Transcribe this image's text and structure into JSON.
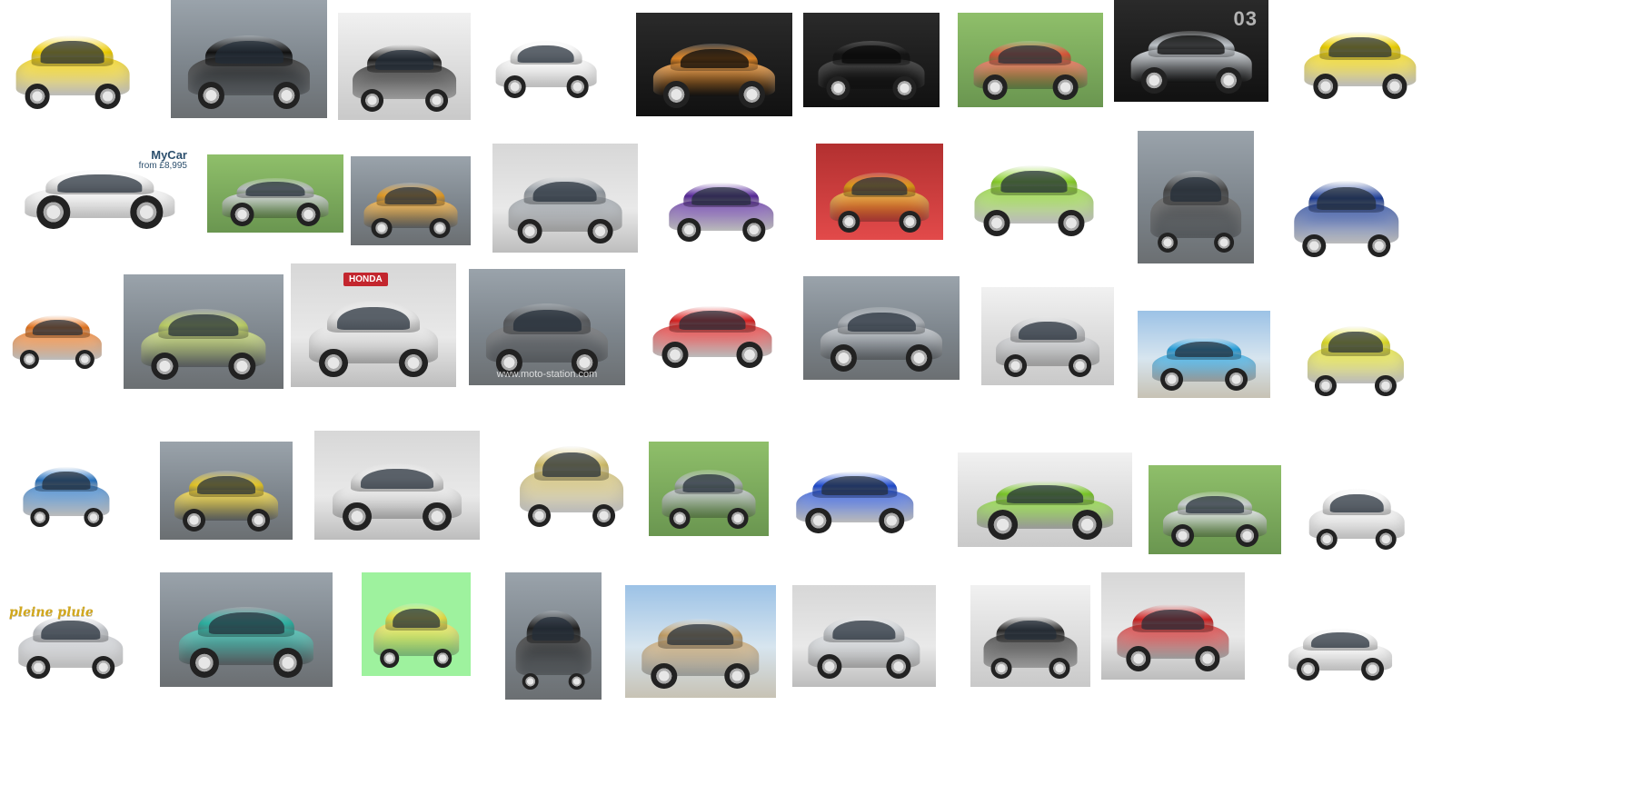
{
  "tiles": [
    {
      "name": "car-buggy-yellow-gray",
      "color": "#f2d000",
      "theme": "white"
    },
    {
      "name": "car-roadster-black-red",
      "color": "#121212",
      "theme": "street"
    },
    {
      "name": "car-microcar-black",
      "color": "#1f1f1f",
      "theme": "gray"
    },
    {
      "name": "car-hatch-white",
      "color": "#f7f7f7",
      "theme": "white"
    },
    {
      "name": "car-suv-orange",
      "color": "#e98c28",
      "theme": "dark"
    },
    {
      "name": "car-hatch-black-red",
      "color": "#161616",
      "theme": "dark"
    },
    {
      "name": "car-bubble-red",
      "color": "#e45b3e",
      "theme": "green"
    },
    {
      "name": "car-pod-silver",
      "color": "#c9cfd5",
      "theme": "dark",
      "label": "03"
    },
    {
      "name": "car-bubble-yellow",
      "color": "#f1d400",
      "theme": "white"
    },
    {
      "name": "car-mycar-white",
      "color": "#f4f4f4",
      "theme": "white",
      "badge_title": "MyCar",
      "badge_sub": "from £8,995"
    },
    {
      "name": "car-hatch-silver",
      "color": "#c8ccd1",
      "theme": "green"
    },
    {
      "name": "car-minivan-orange",
      "color": "#f0a52a",
      "theme": "street"
    },
    {
      "name": "car-concept-silver",
      "color": "#9aa1a8",
      "theme": "show"
    },
    {
      "name": "car-hatch-purple",
      "color": "#5b2aa0",
      "theme": "white"
    },
    {
      "name": "car-concept-yellow",
      "color": "#e6a41a",
      "theme": "red"
    },
    {
      "name": "car-hatch-lime",
      "color": "#8ad22a",
      "theme": "white"
    },
    {
      "name": "car-compact-graphite",
      "color": "#4a4a4a",
      "theme": "street"
    },
    {
      "name": "car-gem-blue-white",
      "color": "#1d3f9a",
      "theme": "white"
    },
    {
      "name": "car-hatch-orange",
      "color": "#f07a20",
      "theme": "white"
    },
    {
      "name": "car-bubble-lime",
      "color": "#c2d56a",
      "theme": "street"
    },
    {
      "name": "car-honda-open",
      "color": "#e8e8e8",
      "theme": "show",
      "label": "HONDA"
    },
    {
      "name": "car-concept-gray",
      "color": "#5d5f62",
      "theme": "street",
      "label": "www.moto-station.com"
    },
    {
      "name": "car-boxy-red-white",
      "color": "#e02222",
      "theme": "white"
    },
    {
      "name": "car-concept-silver-2",
      "color": "#b7bcc2",
      "theme": "street"
    },
    {
      "name": "car-pod-gray",
      "color": "#c7c9cc",
      "theme": "gray"
    },
    {
      "name": "car-convertible-blue",
      "color": "#2aa8e6",
      "theme": "sky"
    },
    {
      "name": "car-buggy-yellow-black",
      "color": "#e2e02a",
      "theme": "white"
    },
    {
      "name": "car-front-blue",
      "color": "#2b79c9",
      "theme": "white"
    },
    {
      "name": "car-bubble-yellow-2",
      "color": "#f0d02a",
      "theme": "street"
    },
    {
      "name": "car-pod-white-black",
      "color": "#e9e9e9",
      "theme": "show"
    },
    {
      "name": "car-twizy-gold",
      "color": "#d2bf6b",
      "theme": "white"
    },
    {
      "name": "car-front-silver",
      "color": "#b9bec4",
      "theme": "green"
    },
    {
      "name": "car-bubble-blue",
      "color": "#1f4dd6",
      "theme": "white"
    },
    {
      "name": "car-hatch-green-black",
      "color": "#7fd02a",
      "theme": "gray"
    },
    {
      "name": "car-utility-silver",
      "color": "#d9dde1",
      "theme": "green"
    },
    {
      "name": "car-utility-white",
      "color": "#f0f0f0",
      "theme": "white"
    },
    {
      "name": "car-minivan-silver",
      "color": "#c9ccd1",
      "theme": "white",
      "label": "pleine pluie"
    },
    {
      "name": "car-concept-teal",
      "color": "#2fb6a6",
      "theme": "street"
    },
    {
      "name": "car-pod-yellow",
      "color": "#f2e44a",
      "theme": "lime"
    },
    {
      "name": "car-pod-black-white",
      "color": "#222222",
      "theme": "street"
    },
    {
      "name": "car-jeep-tan",
      "color": "#c8a36a",
      "theme": "sky"
    },
    {
      "name": "car-concept-silver-3",
      "color": "#d3d7db",
      "theme": "show"
    },
    {
      "name": "car-pod-dark",
      "color": "#2b2b2b",
      "theme": "gray"
    },
    {
      "name": "car-hatch-red",
      "color": "#d62424",
      "theme": "show"
    },
    {
      "name": "car-beach-white-blue",
      "color": "#f6f6f6",
      "theme": "white"
    }
  ]
}
